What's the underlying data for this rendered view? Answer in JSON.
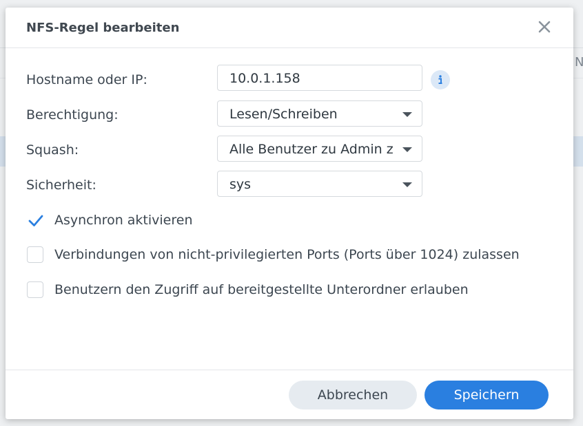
{
  "background": {
    "partial_column_letter": "N"
  },
  "dialog": {
    "title": "NFS-Regel bearbeiten",
    "close_icon": "close-icon",
    "fields": {
      "hostname": {
        "label": "Hostname oder IP:",
        "value": "10.0.1.158"
      },
      "permission": {
        "label": "Berechtigung:",
        "value": "Lesen/Schreiben"
      },
      "squash": {
        "label": "Squash:",
        "value": "Alle Benutzer zu Admin z"
      },
      "security": {
        "label": "Sicherheit:",
        "value": "sys"
      }
    },
    "info_icon": "info-icon",
    "checkboxes": [
      {
        "label": "Asynchron aktivieren",
        "checked": true
      },
      {
        "label": "Verbindungen von nicht-privilegierten Ports (Ports über 1024) zulassen",
        "checked": false
      },
      {
        "label": "Benutzern den Zugriff auf bereitgestellte Unterordner erlauben",
        "checked": false
      }
    ],
    "buttons": {
      "cancel": "Abbrechen",
      "save": "Speichern"
    }
  },
  "colors": {
    "accent": "#2a7fe0",
    "check": "#2a7fe0",
    "selected_row": "#d4e0ec"
  }
}
